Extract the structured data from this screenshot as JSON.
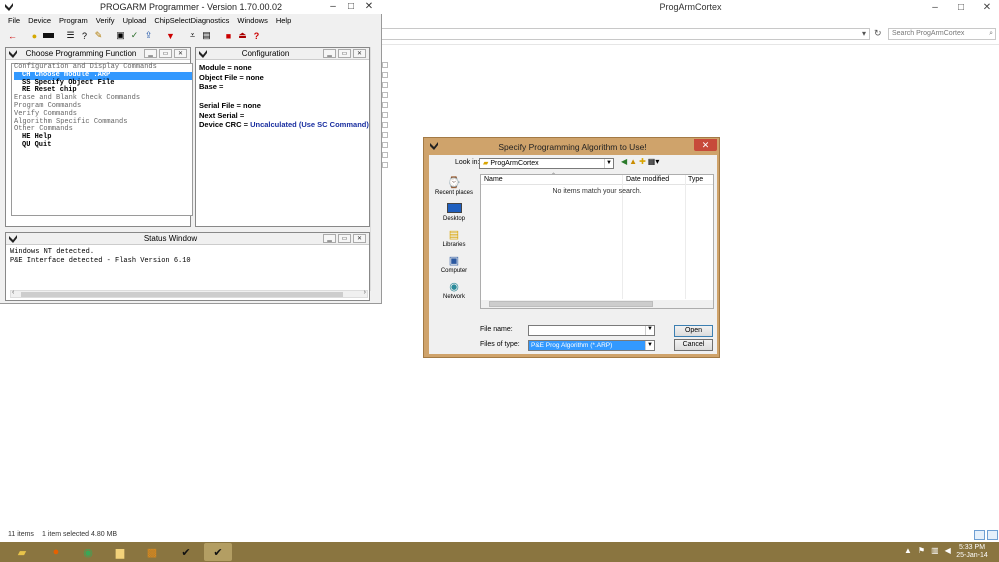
{
  "background_window": {
    "title": "ProgArmCortex",
    "search_placeholder": "Search ProgArmCortex",
    "status_items": "11 items",
    "status_selected": "1 item selected  4.80 MB"
  },
  "progarm": {
    "title": "PROGARM Programmer - Version 1.70.00.02",
    "menu": [
      "File",
      "Device",
      "Program",
      "Verify",
      "Upload",
      "ChipSelectDiagnostics",
      "Windows",
      "Help"
    ],
    "choose_panel": {
      "title": "Choose Programming Function",
      "lines": [
        {
          "text": "Configuration and Display Commands",
          "kind": "head"
        },
        {
          "text": "CH Choose module .ARP",
          "kind": "item",
          "selected": true
        },
        {
          "text": "SS Specify Object File",
          "kind": "item"
        },
        {
          "text": "RE Reset chip",
          "kind": "item"
        },
        {
          "text": "Erase and Blank Check Commands",
          "kind": "head"
        },
        {
          "text": "Program Commands",
          "kind": "head"
        },
        {
          "text": "Verify Commands",
          "kind": "head"
        },
        {
          "text": "Algorithm Specific Commands",
          "kind": "head"
        },
        {
          "text": "Other Commands",
          "kind": "head"
        },
        {
          "text": "HE Help",
          "kind": "item"
        },
        {
          "text": "QU Quit",
          "kind": "item"
        }
      ]
    },
    "config_panel": {
      "title": "Configuration",
      "module": "Module = none",
      "object_file": "Object File = none",
      "base": "Base =",
      "serial_file": "Serial File = none",
      "next_serial": "Next Serial =",
      "device_crc_label": "Device CRC =",
      "device_crc_value": "Uncalculated (Use SC Command)"
    },
    "status_panel": {
      "title": "Status Window",
      "lines": [
        "Windows NT detected.",
        "P&E Interface detected - Flash Version 6.10"
      ]
    }
  },
  "dialog": {
    "title": "Specify Programming Algorithm to Use!",
    "look_in_label": "Look in:",
    "look_in_value": "ProgArmCortex",
    "places": [
      "Recent places",
      "Desktop",
      "Libraries",
      "Computer",
      "Network"
    ],
    "columns": [
      "Name",
      "Date modified",
      "Type"
    ],
    "empty_message": "No items match your search.",
    "file_name_label": "File name:",
    "file_name_value": "",
    "files_of_type_label": "Files of type:",
    "files_of_type_value": "P&E Prog Algorithm (*.ARP)",
    "open_label": "Open",
    "cancel_label": "Cancel"
  },
  "taskbar": {
    "time": "5:33 PM",
    "date": "25-Jan-14"
  }
}
